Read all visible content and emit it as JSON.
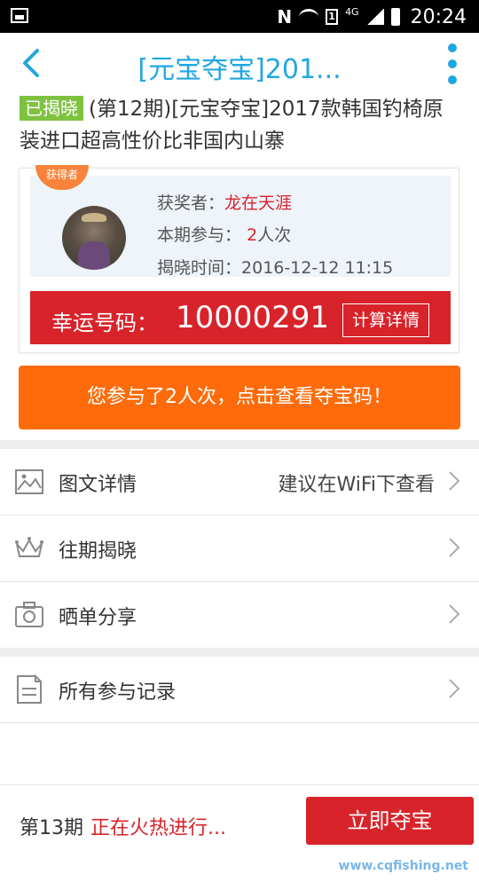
{
  "status_bar": {
    "network": "4G",
    "sim": "1",
    "time": "20:24"
  },
  "header": {
    "title": "[元宝夺宝]201..."
  },
  "product": {
    "badge": "已揭晓",
    "title": "(第12期)[元宝夺宝]2017款韩国钓椅原装进口超高性价比非国内山寨"
  },
  "winner": {
    "ribbon": "获得者",
    "winner_label": "获奖者：",
    "winner_name": "龙在天涯",
    "participation_label": "本期参与：",
    "participation_count": "2",
    "participation_unit": "人次",
    "reveal_label": "揭晓时间：",
    "reveal_time": "2016-12-12 11:15",
    "lucky_label": "幸运号码：",
    "lucky_number": "10000291",
    "calc_button": "计算详情"
  },
  "cta": {
    "codes_button": "您参与了2人次，点击查看夺宝码！"
  },
  "menu": {
    "details": {
      "label": "图文详情",
      "hint": "建议在WiFi下查看",
      "icon": "image-icon"
    },
    "history": {
      "label": "往期揭晓",
      "icon": "crown-icon"
    },
    "share": {
      "label": "晒单分享",
      "icon": "camera-icon"
    },
    "records": {
      "label": "所有参与记录",
      "icon": "document-icon"
    }
  },
  "bottom": {
    "period": "第13期",
    "status": "正在火热进行...",
    "buy_button": "立即夺宝",
    "watermark": "www.cqfishing.net"
  },
  "colors": {
    "accent_blue": "#21a7e0",
    "red": "#d8232a",
    "orange": "#ff6b0a",
    "green_badge": "#7fc240"
  }
}
